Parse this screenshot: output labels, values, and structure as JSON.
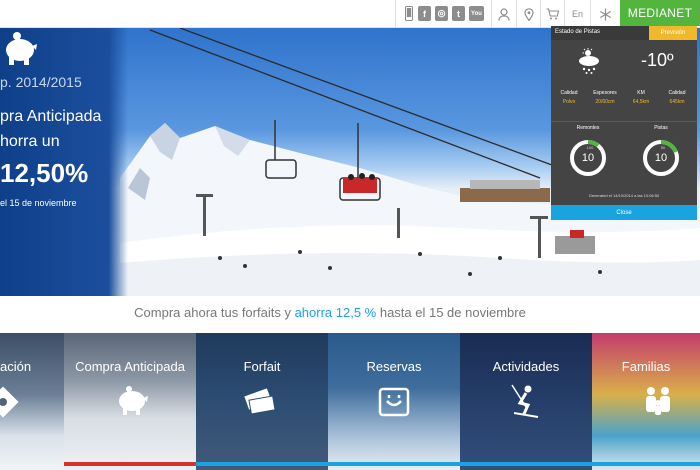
{
  "topbar": {
    "social": [
      "f",
      "◎",
      "t",
      "You"
    ],
    "lang": "En",
    "medianet_label": "MEDIANET"
  },
  "promo": {
    "season": "p. 2014/2015",
    "line1": "pra Anticipada",
    "line2": "horra un",
    "big": "12,50%",
    "date": "el 15 de noviembre"
  },
  "widget": {
    "tab_estado": "Estado de Pistas",
    "tab_prevision": "Previsión",
    "temperature": "-10º",
    "stats": [
      {
        "label": "Calidad",
        "value": "Polvo"
      },
      {
        "label": "Espesores",
        "value": "20/60cm"
      },
      {
        "label": "KM",
        "value": "64,5km"
      },
      {
        "label": "Calidad",
        "value": "645km"
      }
    ],
    "remontes_label": "Remontes",
    "pistas_label": "Pistas",
    "remontes_value": "10",
    "remontes_total": "100",
    "pistas_value": "10",
    "pistas_total": "50",
    "generated": "Generated el 14/10/2014 a las 10:06:50",
    "close_label": "Close"
  },
  "tagline": {
    "before": "Compra ahora tus forfaits y ",
    "highlight": "ahorra 12,5 %",
    "after": " hasta el 15 de noviembre"
  },
  "tiles": [
    {
      "label": "ación"
    },
    {
      "label": "Compra Anticipada"
    },
    {
      "label": "Forfait"
    },
    {
      "label": "Reservas"
    },
    {
      "label": "Actividades"
    },
    {
      "label": "Familias"
    }
  ],
  "colors": {
    "brand_green": "#53b43e",
    "accent_blue": "#19a3e0",
    "accent_yellow": "#f0b82b",
    "promo_blue": "#1b4f9e",
    "tile_bar_red": "#d6332e"
  }
}
